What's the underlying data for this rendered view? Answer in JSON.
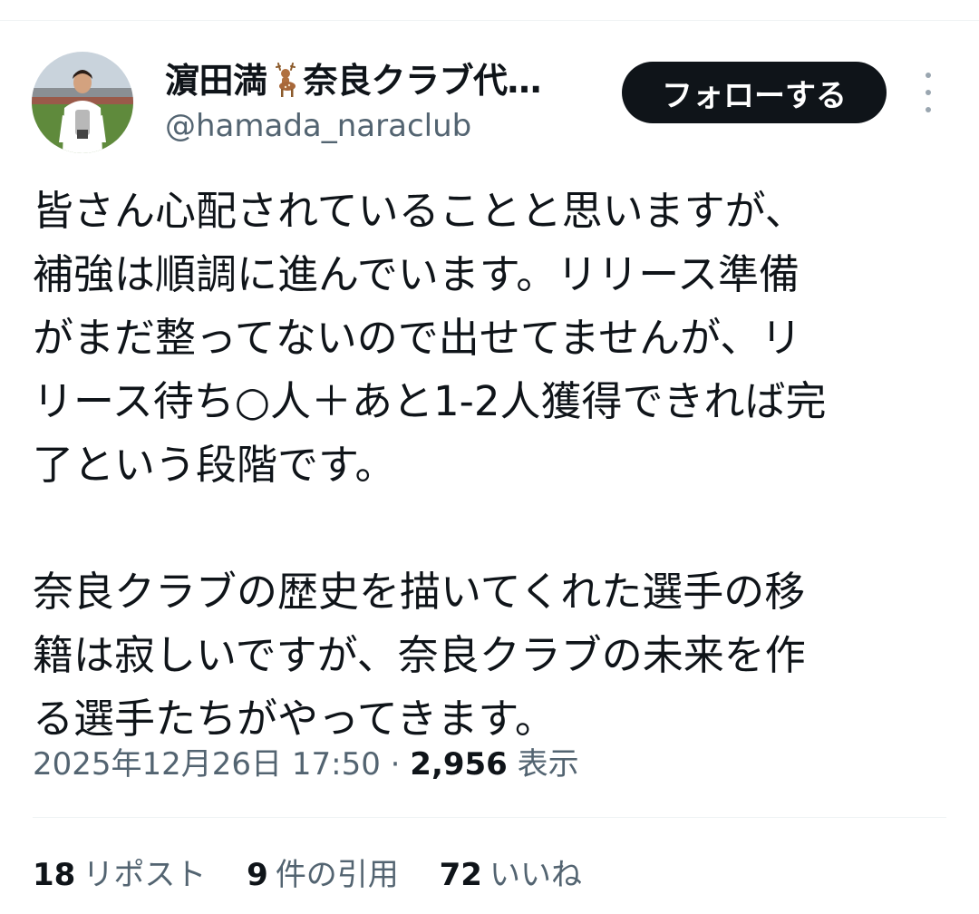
{
  "author": {
    "display_name": "濵田満",
    "display_name_suffix": "奈良クラブ代…",
    "name_icon": "deer-icon",
    "handle": "@hamada_naraclub",
    "avatar_icon": "profile-photo"
  },
  "actions": {
    "follow_label": "フォローする",
    "more_icon": "more-vertical-icon"
  },
  "tweet": {
    "lines_p1": [
      "皆さん心配されていることと思いますが、",
      "補強は順調に進んでいます。リリース準備",
      "がまだ整ってないので出せてませんが、リ",
      "リース待ち○人＋あと1-2人獲得できれば完",
      "了という段階です。"
    ],
    "lines_p2": [
      "奈良クラブの歴史を描いてくれた選手の移",
      "籍は寂しいですが、奈良クラブの未来を作",
      "る選手たちがやってきます。"
    ]
  },
  "meta": {
    "timestamp": "2025年12月26日 17:50",
    "separator": " · ",
    "views_count": "2,956",
    "views_label": "表示"
  },
  "stats": {
    "reposts_count": "18",
    "reposts_label": "リポスト",
    "quotes_count": "9",
    "quotes_label": "件の引用",
    "likes_count": "72",
    "likes_label": "いいね"
  },
  "colors": {
    "text": "#0f1419",
    "secondary": "#536471",
    "button_bg": "#0f1419",
    "divider": "#eff3f4"
  }
}
